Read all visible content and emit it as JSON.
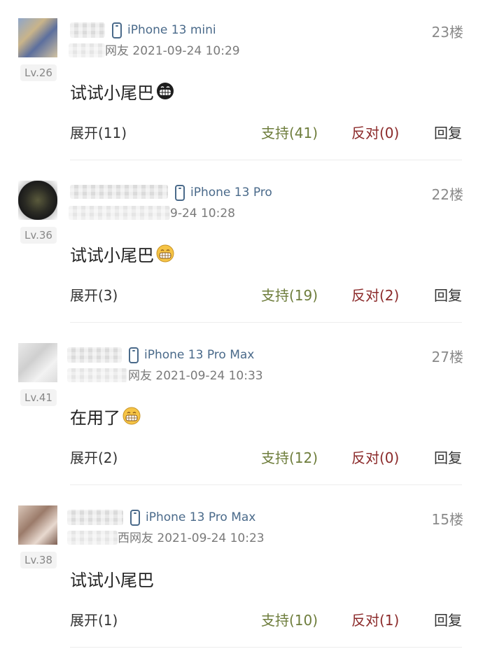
{
  "comments": [
    {
      "level": "Lv.26",
      "device": "iPhone 13 mini",
      "time_suffix": "网友 2021-09-24 10:29",
      "floor": "23楼",
      "content": "试试小尾巴",
      "emoji": "grin-dark-emoji",
      "expand": "展开(11)",
      "support": "支持(41)",
      "oppose": "反对(0)",
      "reply": "回复"
    },
    {
      "level": "Lv.36",
      "device": "iPhone 13 Pro",
      "time_suffix": "9-24 10:28",
      "floor": "22楼",
      "content": "试试小尾巴",
      "emoji": "grin-emoji",
      "expand": "展开(3)",
      "support": "支持(19)",
      "oppose": "反对(2)",
      "reply": "回复"
    },
    {
      "level": "Lv.41",
      "device": "iPhone 13 Pro Max",
      "time_suffix": "网友 2021-09-24 10:33",
      "floor": "27楼",
      "content": "在用了",
      "emoji": "grin-emoji",
      "expand": "展开(2)",
      "support": "支持(12)",
      "oppose": "反对(0)",
      "reply": "回复"
    },
    {
      "level": "Lv.38",
      "device": "iPhone 13 Pro Max",
      "time_suffix": "西网友 2021-09-24 10:23",
      "floor": "15楼",
      "content": "试试小尾巴",
      "emoji": "",
      "expand": "展开(1)",
      "support": "支持(10)",
      "oppose": "反对(1)",
      "reply": "回复"
    }
  ],
  "colors": {
    "device_text": "#4a6a8a",
    "support": "#6e7d3c",
    "oppose": "#8b2a2a",
    "meta_text": "#7a7a7a"
  }
}
